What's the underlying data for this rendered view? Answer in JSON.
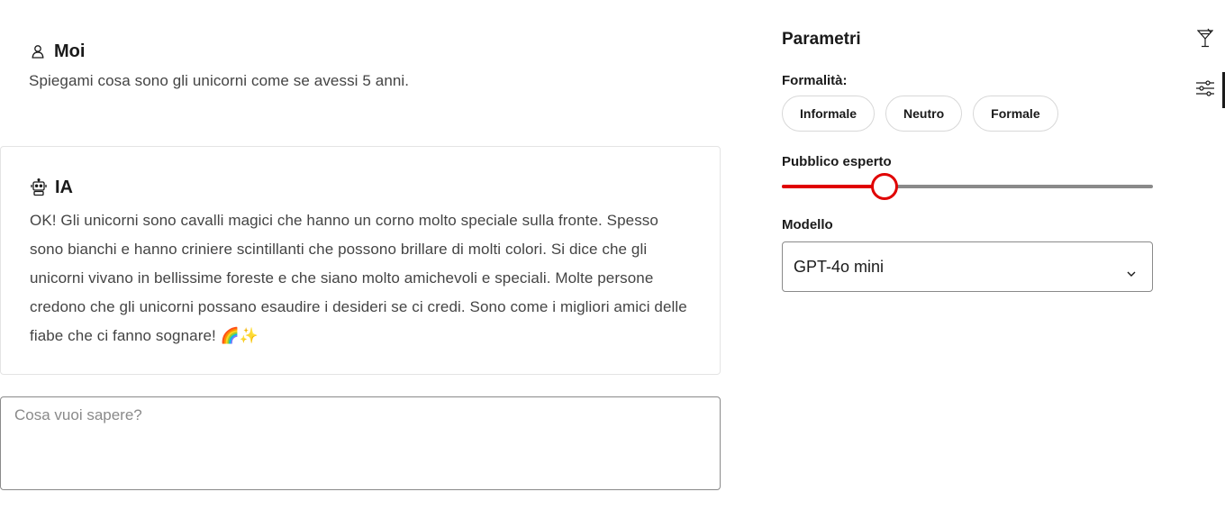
{
  "chat": {
    "user": {
      "name": "Moi",
      "icon": "user-icon",
      "text": "Spiegami cosa sono gli unicorni come se avessi 5 anni."
    },
    "ai": {
      "name": "IA",
      "icon": "robot-icon",
      "text": "OK! Gli unicorni sono cavalli magici che hanno un corno molto speciale sulla fronte. Spesso sono bianchi e hanno criniere scintillanti che possono brillare di molti colori. Si dice che gli unicorni vivano in bellissime foreste e che siano molto amichevoli e speciali. Molte persone credono che gli unicorni possano esaudire i desideri se ci credi. Sono come i migliori amici delle fiabe che ci fanno sognare! 🌈✨"
    },
    "input": {
      "placeholder": "Cosa vuoi sapere?",
      "value": ""
    }
  },
  "params": {
    "title": "Parametri",
    "formality": {
      "label": "Formalità:",
      "options": [
        "Informale",
        "Neutro",
        "Formale"
      ]
    },
    "expert": {
      "label": "Pubblico esperto",
      "level": 0.277
    },
    "model": {
      "label": "Modello",
      "selected": "GPT-4o mini"
    }
  },
  "rail": {
    "items": [
      "cocktail-icon",
      "sliders-icon"
    ]
  },
  "colors": {
    "accent": "#e00000",
    "border": "#e4e4e4",
    "text": "#1a1a1a",
    "muted": "#444444"
  }
}
